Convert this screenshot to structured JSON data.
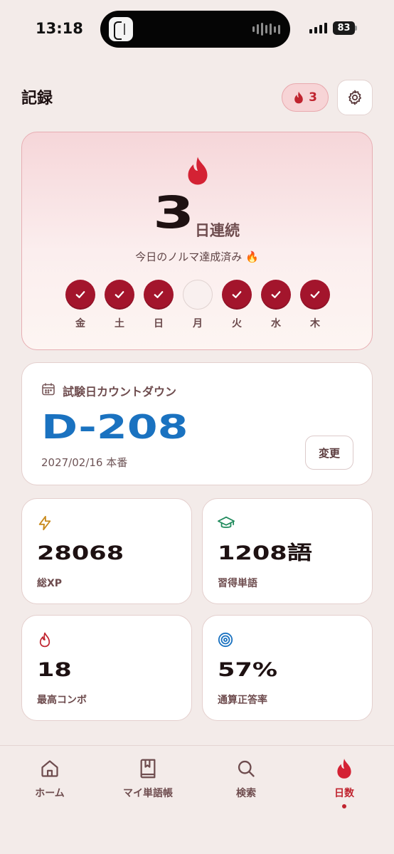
{
  "status": {
    "time": "13:18",
    "battery": "83"
  },
  "header": {
    "title": "記録",
    "streak_badge": "3"
  },
  "streak": {
    "count": "3",
    "unit": "日連続",
    "message": "今日のノルマ達成済み 🔥",
    "days": [
      {
        "label": "金",
        "done": true
      },
      {
        "label": "土",
        "done": true
      },
      {
        "label": "日",
        "done": true
      },
      {
        "label": "月",
        "done": false
      },
      {
        "label": "火",
        "done": true
      },
      {
        "label": "水",
        "done": true
      },
      {
        "label": "木",
        "done": true
      }
    ]
  },
  "countdown": {
    "label": "試験日カウントダウン",
    "value": "D-208",
    "date": "2027/02/16 本番",
    "change_label": "変更"
  },
  "stats": [
    {
      "value": "28068",
      "label": "総XP",
      "icon": "lightning-icon",
      "color": "#c98a1c"
    },
    {
      "value": "1208語",
      "label": "習得単語",
      "icon": "graduation-cap-icon",
      "color": "#1f8a5c"
    },
    {
      "value": "18",
      "label": "最高コンボ",
      "icon": "flame-icon",
      "color": "#c0242f"
    },
    {
      "value": "57%",
      "label": "通算正答率",
      "icon": "target-icon",
      "color": "#1a72c0"
    }
  ],
  "nav": [
    {
      "label": "ホーム",
      "icon": "home-icon"
    },
    {
      "label": "マイ単語帳",
      "icon": "bookmark-book-icon"
    },
    {
      "label": "検索",
      "icon": "search-icon"
    },
    {
      "label": "日数",
      "icon": "flame-icon",
      "active": true
    }
  ],
  "colors": {
    "accent": "#c0242f",
    "day_done": "#a3152c",
    "countdown": "#1a72c0",
    "background": "#f3ebe9"
  }
}
